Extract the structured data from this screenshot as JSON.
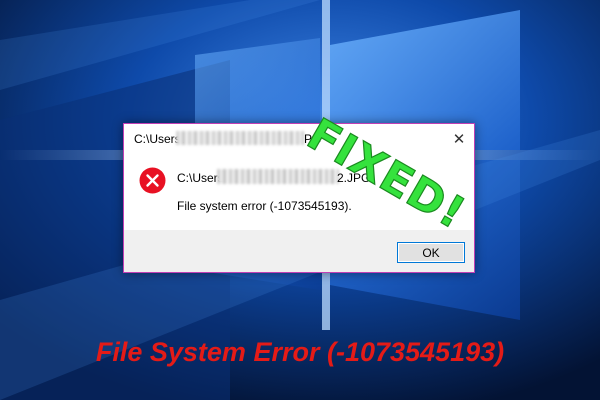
{
  "dialog": {
    "title_start": "C:\\Users\\",
    "title_end": "PG",
    "message_path_start": "C:\\Users",
    "message_path_end": "2.JPG",
    "message_error": "File system error (-1073545193).",
    "ok_label": "OK",
    "close_glyph": "✕",
    "icon": "error-icon"
  },
  "stamp": {
    "text": "FIXED!",
    "color": "#35e23d"
  },
  "caption": {
    "text": "File System Error (-1073545193)",
    "color": "#e41b17"
  },
  "colors": {
    "desktop_background": "#0a3a8c",
    "dialog_border": "#c13fb4",
    "error_red": "#e81123"
  }
}
